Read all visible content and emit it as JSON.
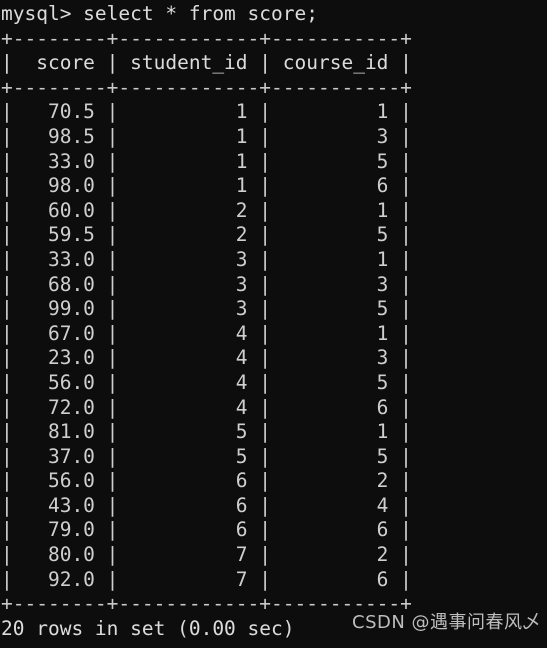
{
  "terminal": {
    "prompt_line": "mysql> select * from score;",
    "footer_line": "20 rows in set (0.00 sec)",
    "watermark": "CSDN @遇事问春风乄",
    "background_color": "#0d0d0d",
    "text_color": "#d8d8d8"
  },
  "table": {
    "rule": "+--------+------------+-----------+",
    "header": "|  score | student_id | course_id |",
    "columns": [
      "score",
      "student_id",
      "course_id"
    ],
    "row_count": 20,
    "rows": [
      "|   70.5 |          1 |         1 |",
      "|   98.5 |          1 |         3 |",
      "|   33.0 |          1 |         5 |",
      "|   98.0 |          1 |         6 |",
      "|   60.0 |          2 |         1 |",
      "|   59.5 |          2 |         5 |",
      "|   33.0 |          3 |         1 |",
      "|   68.0 |          3 |         3 |",
      "|   99.0 |          3 |         5 |",
      "|   67.0 |          4 |         1 |",
      "|   23.0 |          4 |         3 |",
      "|   56.0 |          4 |         5 |",
      "|   72.0 |          4 |         6 |",
      "|   81.0 |          5 |         1 |",
      "|   37.0 |          5 |         5 |",
      "|   56.0 |          6 |         2 |",
      "|   43.0 |          6 |         4 |",
      "|   79.0 |          6 |         6 |",
      "|   80.0 |          7 |         2 |",
      "|   92.0 |          7 |         6 |"
    ],
    "records": [
      {
        "score": "70.5",
        "student_id": "1",
        "course_id": "1"
      },
      {
        "score": "98.5",
        "student_id": "1",
        "course_id": "3"
      },
      {
        "score": "33.0",
        "student_id": "1",
        "course_id": "5"
      },
      {
        "score": "98.0",
        "student_id": "1",
        "course_id": "6"
      },
      {
        "score": "60.0",
        "student_id": "2",
        "course_id": "1"
      },
      {
        "score": "59.5",
        "student_id": "2",
        "course_id": "5"
      },
      {
        "score": "33.0",
        "student_id": "3",
        "course_id": "1"
      },
      {
        "score": "68.0",
        "student_id": "3",
        "course_id": "3"
      },
      {
        "score": "99.0",
        "student_id": "3",
        "course_id": "5"
      },
      {
        "score": "67.0",
        "student_id": "4",
        "course_id": "1"
      },
      {
        "score": "23.0",
        "student_id": "4",
        "course_id": "3"
      },
      {
        "score": "56.0",
        "student_id": "4",
        "course_id": "5"
      },
      {
        "score": "72.0",
        "student_id": "4",
        "course_id": "6"
      },
      {
        "score": "81.0",
        "student_id": "5",
        "course_id": "1"
      },
      {
        "score": "37.0",
        "student_id": "5",
        "course_id": "5"
      },
      {
        "score": "56.0",
        "student_id": "6",
        "course_id": "2"
      },
      {
        "score": "43.0",
        "student_id": "6",
        "course_id": "4"
      },
      {
        "score": "79.0",
        "student_id": "6",
        "course_id": "6"
      },
      {
        "score": "80.0",
        "student_id": "7",
        "course_id": "2"
      },
      {
        "score": "92.0",
        "student_id": "7",
        "course_id": "6"
      }
    ]
  }
}
